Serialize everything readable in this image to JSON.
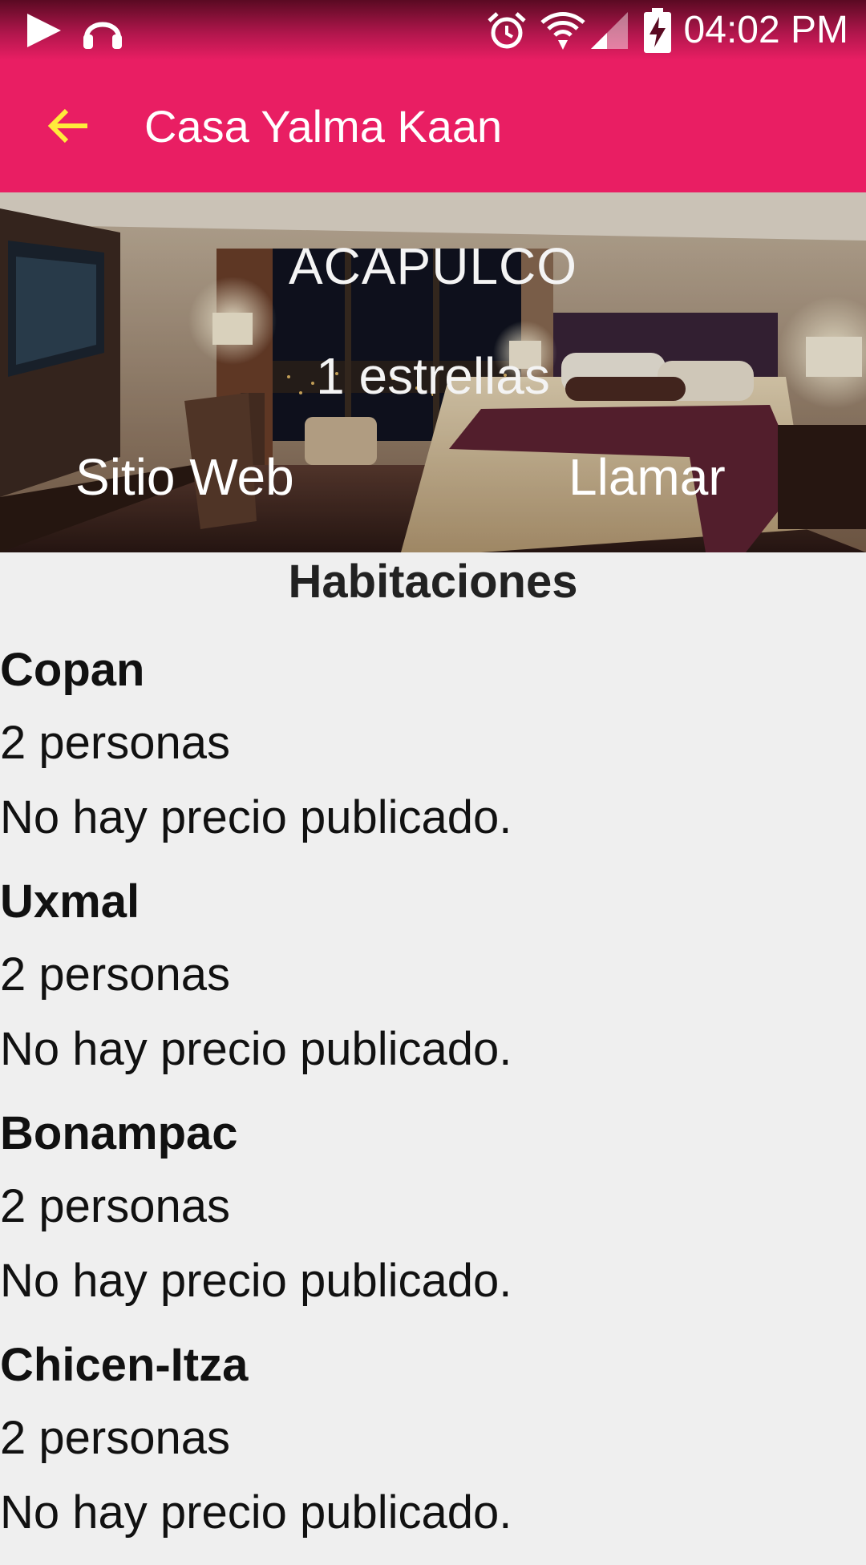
{
  "status_bar": {
    "time": "04:02 PM",
    "icons": [
      "play-icon",
      "headphones-icon",
      "alarm-icon",
      "wifi-icon",
      "cell-signal-icon",
      "battery-charging-icon"
    ]
  },
  "toolbar": {
    "title": "Casa Yalma Kaan",
    "back_icon": "arrow-back-icon"
  },
  "hero": {
    "city": "ACAPULCO",
    "stars": "1 estrellas",
    "website_label": "Sitio Web",
    "call_label": "Llamar"
  },
  "rooms_section": {
    "title": "Habitaciones",
    "rooms": [
      {
        "name": "Copan",
        "capacity": "2 personas",
        "price": "No hay precio publicado."
      },
      {
        "name": "Uxmal",
        "capacity": "2 personas",
        "price": "No hay precio publicado."
      },
      {
        "name": "Bonampac",
        "capacity": "2 personas",
        "price": "No hay precio publicado."
      },
      {
        "name": "Chicen-Itza",
        "capacity": "2 personas",
        "price": "No hay precio publicado."
      }
    ]
  },
  "colors": {
    "primary": "#e91e63",
    "back_arrow": "#ffeb3b",
    "background": "#efefef"
  }
}
